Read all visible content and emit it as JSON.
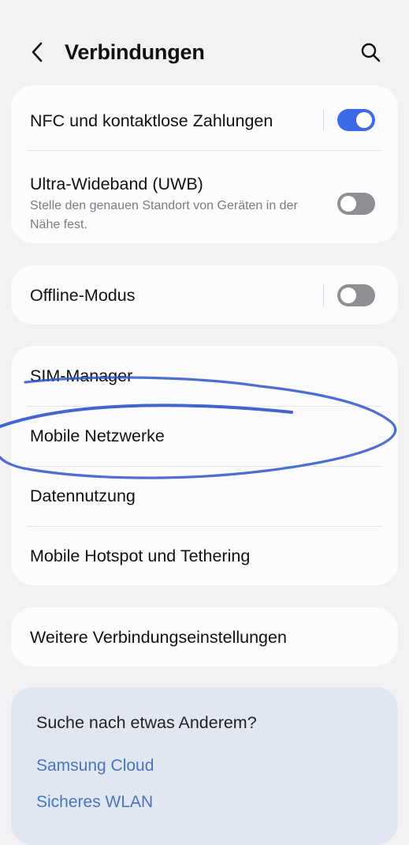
{
  "header": {
    "title": "Verbindungen",
    "back_icon": "chevron-left-icon",
    "search_icon": "search-icon"
  },
  "group1": {
    "nfc": {
      "label": "NFC und kontaktlose Zahlungen",
      "toggle_on": true
    },
    "uwb": {
      "label": "Ultra-Wideband (UWB)",
      "description": "Stelle den genauen Standort von Geräten in der Nähe fest.",
      "toggle_on": false
    }
  },
  "group2": {
    "offline": {
      "label": "Offline-Modus",
      "toggle_on": false
    }
  },
  "group3": {
    "items": [
      {
        "label": "SIM-Manager"
      },
      {
        "label": "Mobile Netzwerke"
      },
      {
        "label": "Datennutzung"
      },
      {
        "label": "Mobile Hotspot und Tethering"
      }
    ]
  },
  "group4": {
    "more": {
      "label": "Weitere Verbindungseinstellungen"
    }
  },
  "suggestions": {
    "title": "Suche nach etwas Anderem?",
    "links": [
      "Samsung Cloud",
      "Sicheres WLAN"
    ]
  },
  "colors": {
    "accent": "#3d6be8",
    "toggle_off": "#8e8e93",
    "link": "#4b74ba",
    "annotation": "#2f55c9"
  }
}
